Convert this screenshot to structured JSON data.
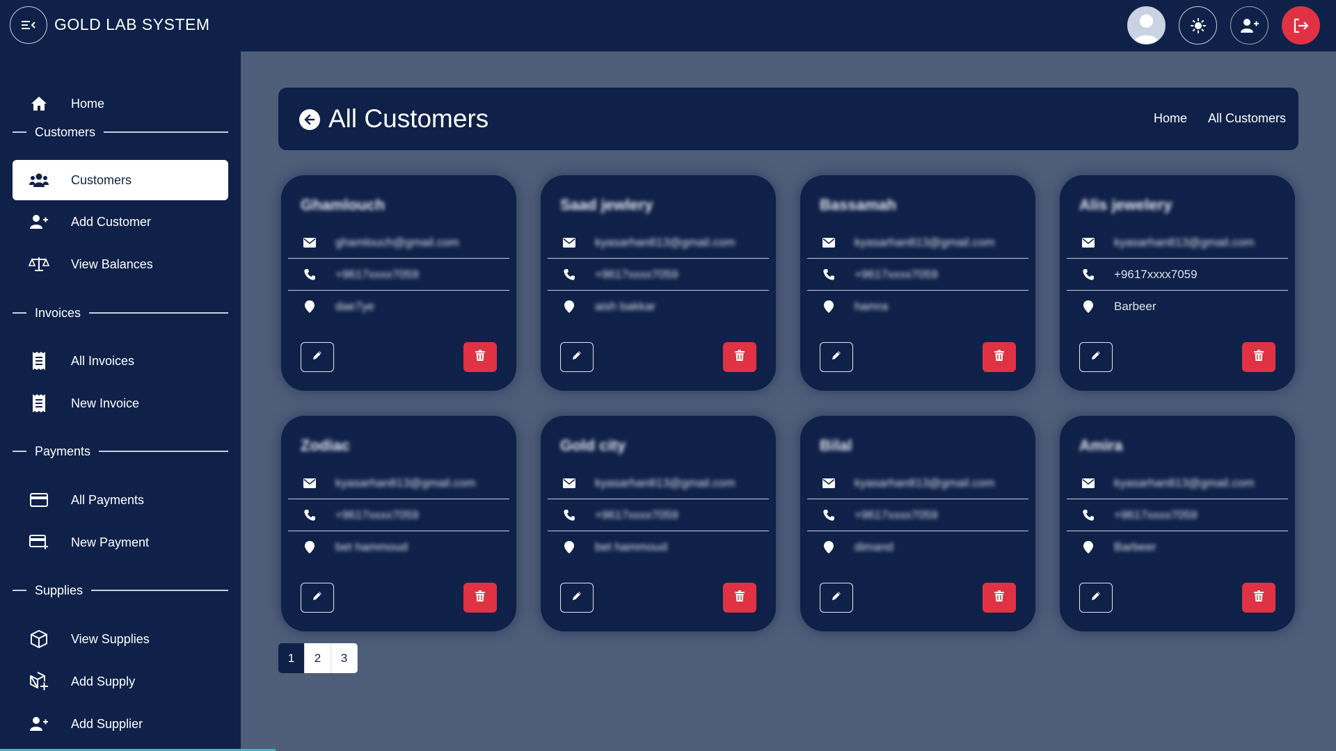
{
  "app": {
    "title": "GOLD LAB SYSTEM"
  },
  "topbar": {
    "icons": [
      "menu-collapse-icon",
      "user-avatar",
      "sun-icon",
      "user-plus-icon",
      "logout-icon"
    ],
    "logout_color": "#e03243"
  },
  "sidebar": {
    "home": "Home",
    "sections": {
      "customers": "Customers",
      "invoices": "Invoices",
      "payments": "Payments",
      "supplies": "Supplies"
    },
    "items": {
      "customers": "Customers",
      "add_customer": "Add Customer",
      "view_balances": "View Balances",
      "all_invoices": "All Invoices",
      "new_invoice": "New Invoice",
      "all_payments": "All Payments",
      "new_payment": "New Payment",
      "view_supplies": "View Supplies",
      "add_supply": "Add Supply",
      "add_supplier": "Add Supplier"
    },
    "active_item": "Customers"
  },
  "header": {
    "title": "All Customers",
    "breadcrumb": [
      "Home",
      "All Customers"
    ]
  },
  "customers": [
    {
      "name": "Ghamlouch",
      "email": "ghamlouch@gmail.com",
      "phone": "+9617xxxx7059",
      "address": "dae7ye",
      "blurred": true
    },
    {
      "name": "Saad jewlery",
      "email": "kyasarhan813@gmail.com",
      "phone": "+9617xxxx7059",
      "address": "aish bakkar",
      "blurred": true
    },
    {
      "name": "Bassamah",
      "email": "kyasarhan813@gmail.com",
      "phone": "+9617xxxx7059",
      "address": "hamra",
      "blurred": true
    },
    {
      "name": "Alis jewelery",
      "email": "kyasarhan813@gmail.com",
      "phone": "+9617xxxx7059",
      "address": "Barbeer",
      "blurred_fields": [
        "name",
        "email"
      ]
    },
    {
      "name": "Zodiac",
      "email": "kyasarhan813@gmail.com",
      "phone": "+9617xxxx7059",
      "address": "bet hammoud",
      "blurred": true
    },
    {
      "name": "Gold city",
      "email": "kyasarhan813@gmail.com",
      "phone": "+9617xxxx7059",
      "address": "bet hammoud",
      "blurred": true
    },
    {
      "name": "Bilal",
      "email": "kyasarhan813@gmail.com",
      "phone": "+9617xxxx7059",
      "address": "dimand",
      "blurred": true
    },
    {
      "name": "Amira",
      "email": "kyasarhan813@gmail.com",
      "phone": "+9617xxxx7059",
      "address": "Barbeer",
      "blurred": true
    }
  ],
  "card_icons": {
    "email": "envelope-icon",
    "phone": "phone-icon",
    "address": "map-pin-icon",
    "edit": "pencil-icon",
    "delete": "trash-icon"
  },
  "pagination": {
    "pages": [
      "1",
      "2",
      "3"
    ],
    "current": "1"
  },
  "colors": {
    "navy": "#0f2148",
    "background": "#4e5d78",
    "danger": "#e03243",
    "white": "#ffffff"
  }
}
